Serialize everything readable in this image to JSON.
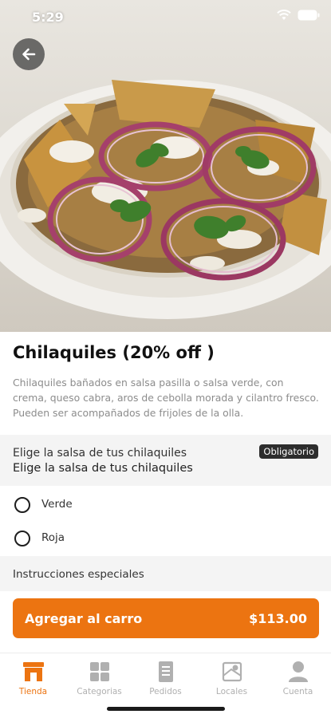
{
  "status_bar": {
    "time": "5:29"
  },
  "product": {
    "title": "Chilaquiles (20% off )",
    "description": "Chilaquiles bañados en salsa pasilla o salsa verde, con crema, queso cabra, aros de cebolla morada y cilantro fresco. Pueden ser acompañados de frijoles de la olla."
  },
  "options_group": {
    "title": "Elige la salsa de tus chilaquiles",
    "subtitle": "Elige la salsa de tus chilaquiles",
    "badge": "Obligatorio",
    "options": [
      {
        "label": "Verde",
        "selected": false
      },
      {
        "label": "Roja",
        "selected": false
      }
    ]
  },
  "special_instructions": {
    "label": "Instrucciones especiales"
  },
  "cart_button": {
    "label": "Agregar al carro",
    "price": "$113.00"
  },
  "bottom_nav": {
    "items": [
      {
        "label": "Tienda",
        "icon": "store-icon",
        "active": true
      },
      {
        "label": "Categorias",
        "icon": "grid-icon",
        "active": false
      },
      {
        "label": "Pedidos",
        "icon": "receipt-icon",
        "active": false
      },
      {
        "label": "Locales",
        "icon": "map-icon",
        "active": false
      },
      {
        "label": "Cuenta",
        "icon": "user-icon",
        "active": false
      }
    ]
  },
  "colors": {
    "accent": "#ec7411",
    "badge": "#2d2d2d",
    "inactive": "#b0b0b0"
  }
}
